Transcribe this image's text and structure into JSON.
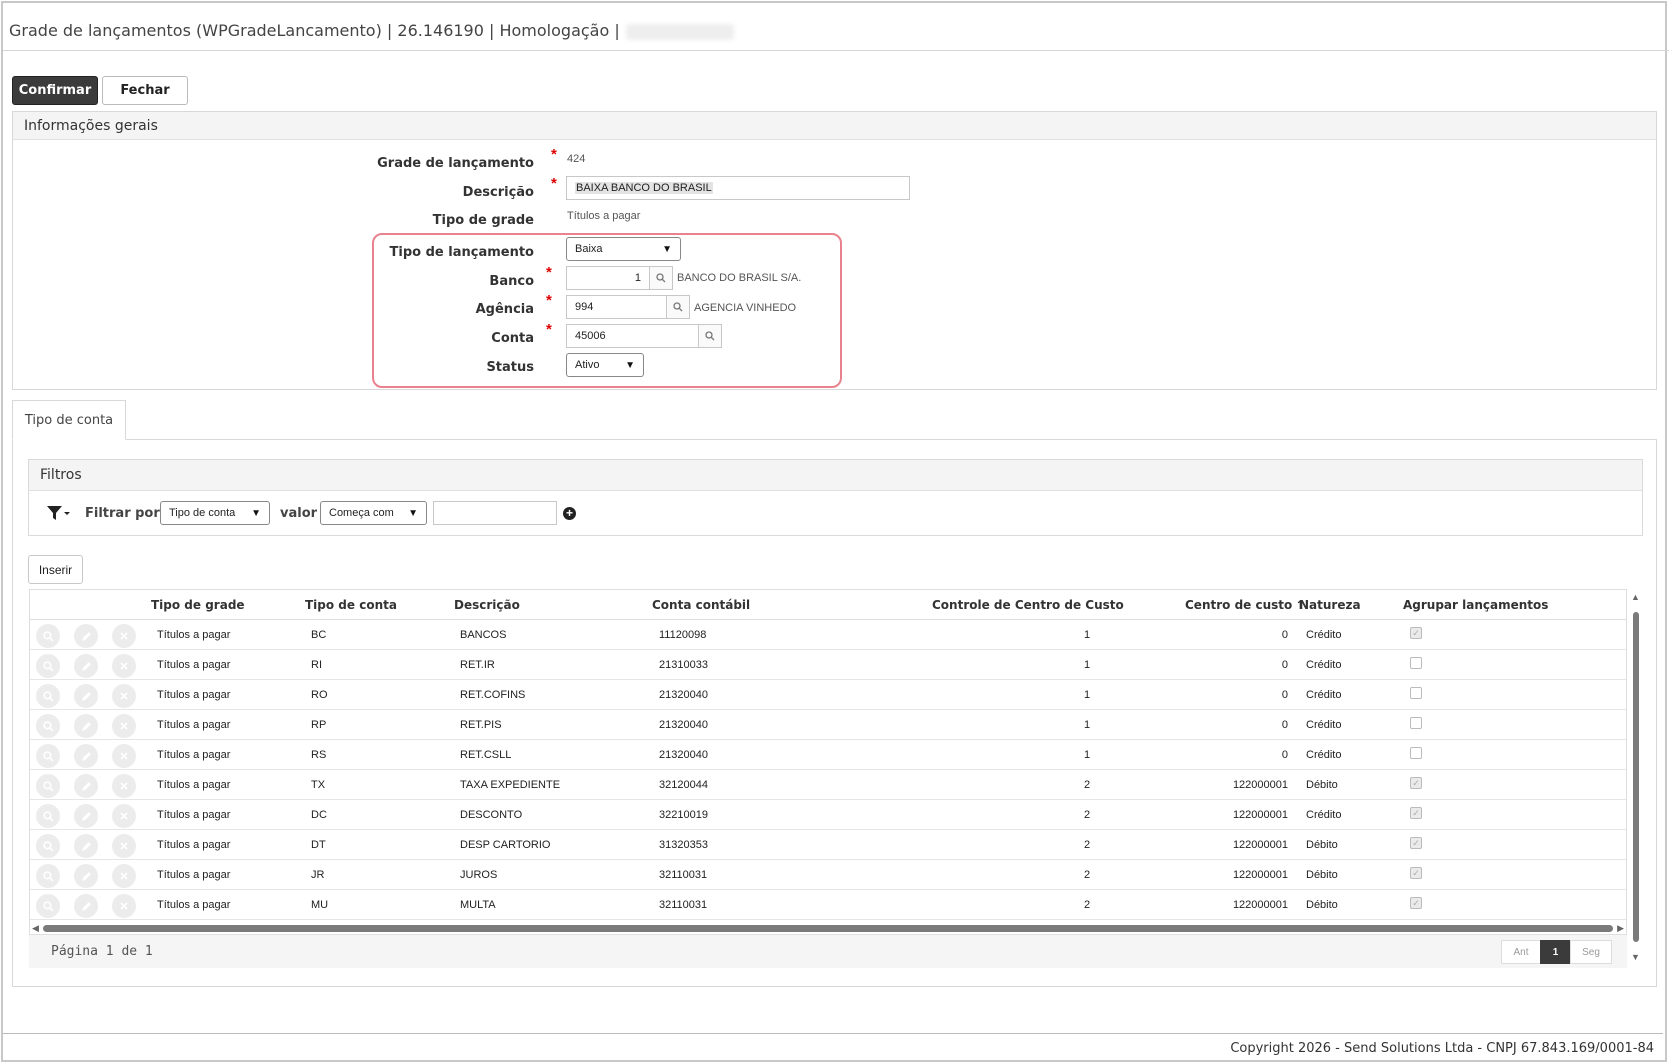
{
  "window": {
    "title": "Grade de lançamentos (WPGradeLancamento) | 26.146190 | Homologação |"
  },
  "toolbar": {
    "confirm_label": "Confirmar",
    "close_label": "Fechar"
  },
  "general": {
    "heading": "Informações gerais",
    "grade_label": "Grade de lançamento",
    "grade_value": "424",
    "descricao_label": "Descrição",
    "descricao_value": "BAIXA BANCO DO BRASIL",
    "tipo_grade_label": "Tipo de grade",
    "tipo_grade_value": "Títulos a pagar",
    "tipo_lanc_label": "Tipo de lançamento",
    "tipo_lanc_value": "Baixa",
    "banco_label": "Banco",
    "banco_value": "1",
    "banco_name": "BANCO DO BRASIL S/A.",
    "agencia_label": "Agência",
    "agencia_value": "994",
    "agencia_name": "AGENCIA VINHEDO",
    "conta_label": "Conta",
    "conta_value": "45006",
    "status_label": "Status",
    "status_value": "Ativo",
    "required_mark": "*"
  },
  "tabs": [
    {
      "label": "Tipo de conta"
    }
  ],
  "filters": {
    "heading": "Filtros",
    "filter_by_label": "Filtrar por",
    "field_value": "Tipo de conta",
    "value_label": "valor",
    "operator_value": "Começa com",
    "text_value": ""
  },
  "insert_label": "Inserir",
  "table": {
    "columns": [
      "Tipo de grade",
      "Tipo de conta",
      "Descrição",
      "Conta contábil",
      "Controle de Centro de Custo",
      "Centro de custo",
      "Natureza",
      "Agrupar lançamentos"
    ],
    "sort_indicator": "↑",
    "rows": [
      {
        "tipo_grade": "Títulos a pagar",
        "tipo_conta": "BC",
        "descricao": "BANCOS",
        "conta": "11120098",
        "controle": "1",
        "centro": "0",
        "natureza": "Crédito",
        "agrupar": true
      },
      {
        "tipo_grade": "Títulos a pagar",
        "tipo_conta": "RI",
        "descricao": "RET.IR",
        "conta": "21310033",
        "controle": "1",
        "centro": "0",
        "natureza": "Crédito",
        "agrupar": false
      },
      {
        "tipo_grade": "Títulos a pagar",
        "tipo_conta": "RO",
        "descricao": "RET.COFINS",
        "conta": "21320040",
        "controle": "1",
        "centro": "0",
        "natureza": "Crédito",
        "agrupar": false
      },
      {
        "tipo_grade": "Títulos a pagar",
        "tipo_conta": "RP",
        "descricao": "RET.PIS",
        "conta": "21320040",
        "controle": "1",
        "centro": "0",
        "natureza": "Crédito",
        "agrupar": false
      },
      {
        "tipo_grade": "Títulos a pagar",
        "tipo_conta": "RS",
        "descricao": "RET.CSLL",
        "conta": "21320040",
        "controle": "1",
        "centro": "0",
        "natureza": "Crédito",
        "agrupar": false
      },
      {
        "tipo_grade": "Títulos a pagar",
        "tipo_conta": "TX",
        "descricao": "TAXA EXPEDIENTE",
        "conta": "32120044",
        "controle": "2",
        "centro": "122000001",
        "natureza": "Débito",
        "agrupar": true
      },
      {
        "tipo_grade": "Títulos a pagar",
        "tipo_conta": "DC",
        "descricao": "DESCONTO",
        "conta": "32210019",
        "controle": "2",
        "centro": "122000001",
        "natureza": "Crédito",
        "agrupar": true
      },
      {
        "tipo_grade": "Títulos a pagar",
        "tipo_conta": "DT",
        "descricao": "DESP CARTORIO",
        "conta": "31320353",
        "controle": "2",
        "centro": "122000001",
        "natureza": "Débito",
        "agrupar": true
      },
      {
        "tipo_grade": "Títulos a pagar",
        "tipo_conta": "JR",
        "descricao": "JUROS",
        "conta": "32110031",
        "controle": "2",
        "centro": "122000001",
        "natureza": "Débito",
        "agrupar": true
      },
      {
        "tipo_grade": "Títulos a pagar",
        "tipo_conta": "MU",
        "descricao": "MULTA",
        "conta": "32110031",
        "controle": "2",
        "centro": "122000001",
        "natureza": "Débito",
        "agrupar": true
      }
    ]
  },
  "pagination": {
    "info": "Página 1 de 1",
    "prev_label": "Ant",
    "current": "1",
    "next_label": "Seg"
  },
  "footer": {
    "copyright": "Copyright 2026 - Send Solutions Ltda - CNPJ 67.843.169/0001-84"
  },
  "colors": {
    "accent_dark": "#3b3b3b",
    "highlight_border": "#e8828f",
    "required": "#dd0000"
  }
}
